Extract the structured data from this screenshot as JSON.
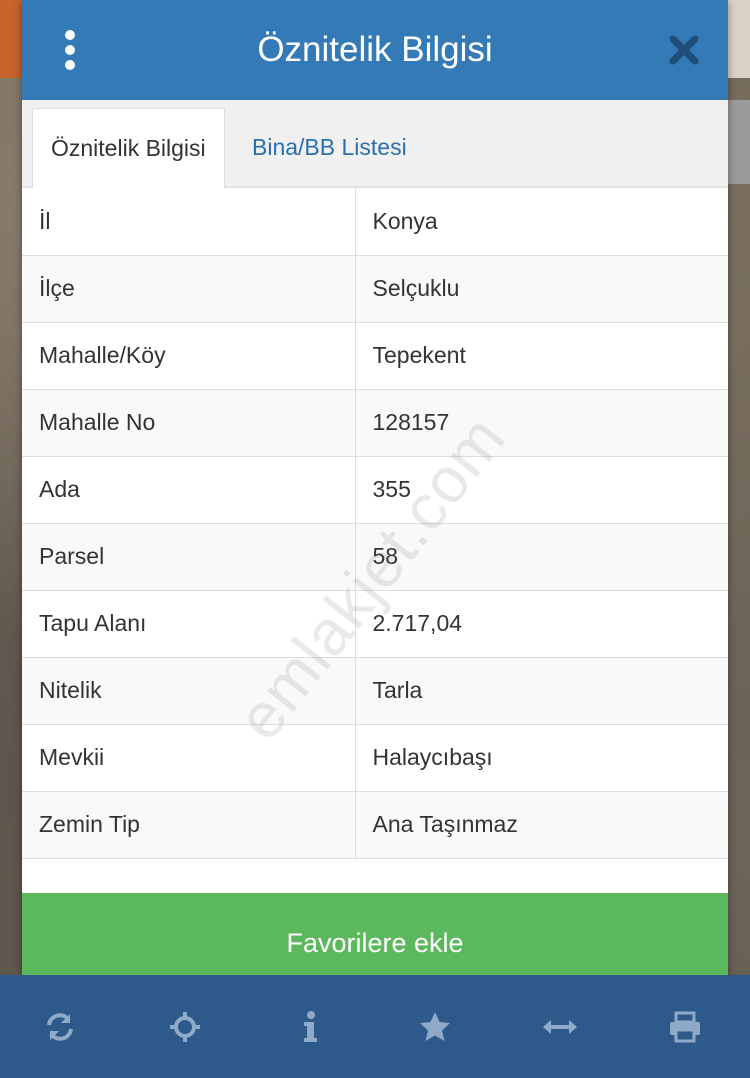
{
  "modal": {
    "title": "Öznitelik Bilgisi",
    "tabs": [
      {
        "label": "Öznitelik Bilgisi",
        "active": true
      },
      {
        "label": "Bina/BB Listesi",
        "active": false
      }
    ],
    "rows": [
      {
        "key": "İl",
        "value": "Konya"
      },
      {
        "key": "İlçe",
        "value": "Selçuklu"
      },
      {
        "key": "Mahalle/Köy",
        "value": "Tepekent"
      },
      {
        "key": "Mahalle No",
        "value": "128157"
      },
      {
        "key": "Ada",
        "value": "355"
      },
      {
        "key": "Parsel",
        "value": "58"
      },
      {
        "key": "Tapu Alanı",
        "value": "2.717,04"
      },
      {
        "key": "Nitelik",
        "value": "Tarla"
      },
      {
        "key": "Mevkii",
        "value": "Halaycıbaşı"
      },
      {
        "key": "Zemin Tip",
        "value": "Ana Taşınmaz"
      }
    ],
    "favorite_button": "Favorilere ekle",
    "watermark": "emlakjet.com"
  },
  "icons": {
    "menu": "kebab-menu-icon",
    "close": "close-icon"
  },
  "toolbar": {
    "items": [
      {
        "name": "refresh-icon"
      },
      {
        "name": "crosshair-icon"
      },
      {
        "name": "info-icon"
      },
      {
        "name": "star-icon"
      },
      {
        "name": "measure-icon"
      },
      {
        "name": "print-icon"
      }
    ]
  },
  "colors": {
    "header": "#337ab7",
    "favorite": "#5cb85c",
    "toolbar": "#2d5a8a",
    "tab_link": "#2a6fb0"
  }
}
